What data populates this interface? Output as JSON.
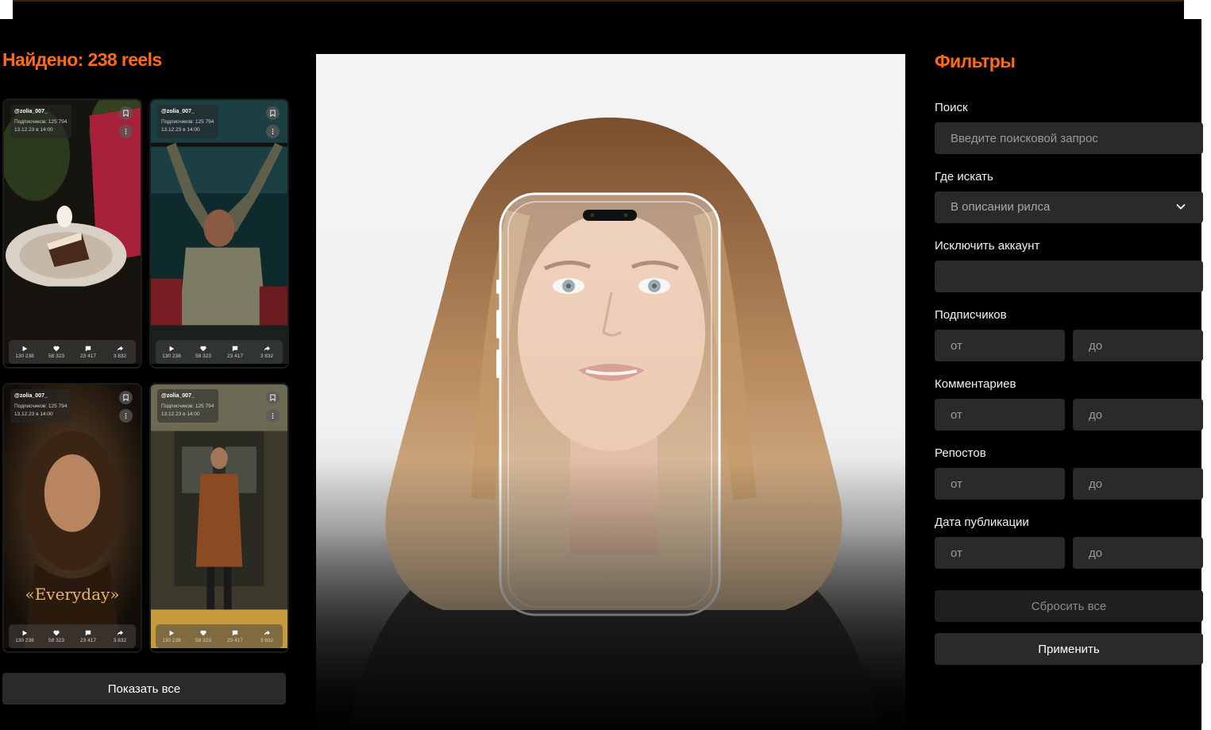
{
  "results": {
    "title": "Найдено: 238 reels",
    "show_all_label": "Показать все",
    "cards": [
      {
        "handle": "@zolia_007_",
        "subscribers": "Подписчиков: 125 794",
        "date": "13.12.23 в 14:00",
        "plays": "130 238",
        "likes": "58 323",
        "comments": "23 417",
        "shares": "3 832"
      },
      {
        "handle": "@zolia_007_",
        "subscribers": "Подписчиков: 125 794",
        "date": "13.12.23 в 14:00",
        "plays": "130 238",
        "likes": "58 323",
        "comments": "23 417",
        "shares": "3 832"
      },
      {
        "handle": "@zolia_007_",
        "subscribers": "Подписчиков: 125 794",
        "date": "13.12.23 в 14:00",
        "plays": "130 238",
        "likes": "58 323",
        "comments": "23 417",
        "shares": "3 832",
        "overlay": "«Everyday»"
      },
      {
        "handle": "@zolia_007_",
        "subscribers": "Подписчиков: 125 794",
        "date": "13.12.23 в 14:00",
        "plays": "130 238",
        "likes": "58 323",
        "comments": "23 417",
        "shares": "3 832"
      }
    ]
  },
  "filters": {
    "title": "Фильтры",
    "search_label": "Поиск",
    "search_placeholder": "Введите поисковой запрос",
    "where_label": "Где искать",
    "where_value": "В описании рилса",
    "exclude_label": "Исключить аккаунт",
    "exclude_value": "",
    "subscribers_label": "Подписчиков",
    "comments_label": "Комментариев",
    "reposts_label": "Репостов",
    "date_label": "Дата публикации",
    "from_placeholder": "от",
    "to_placeholder": "до",
    "reset_label": "Сбросить все",
    "apply_label": "Применить"
  },
  "colors": {
    "accent": "#ff6a13",
    "background": "#000000",
    "field": "#2a2a2a"
  }
}
